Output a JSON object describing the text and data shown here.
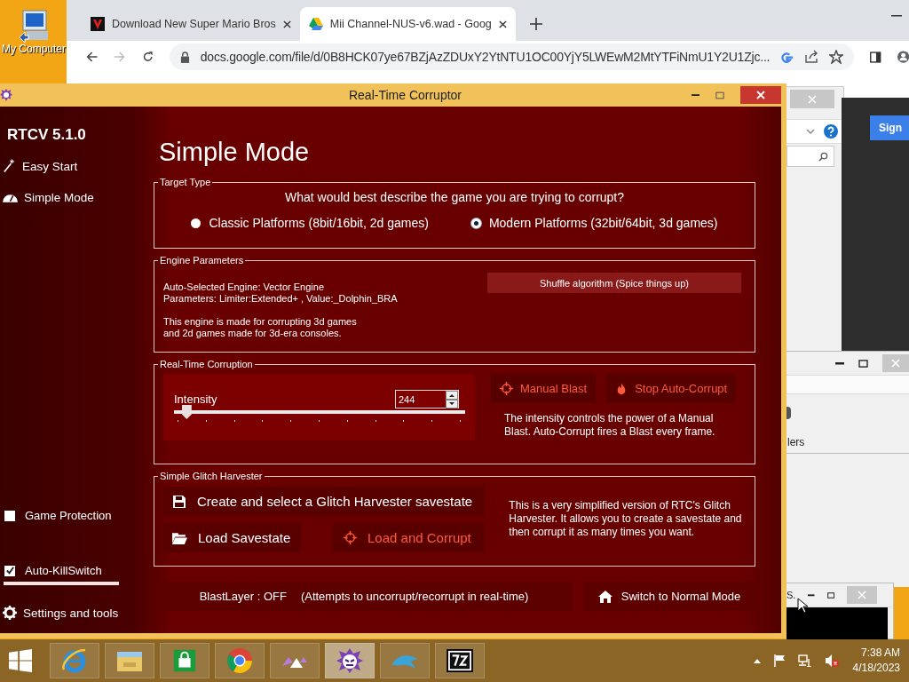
{
  "desktop_icons": [
    {
      "label": "My Computer"
    }
  ],
  "browser": {
    "tabs": [
      {
        "kind": "video",
        "title": "Download New Super Mario Bros",
        "selected": false
      },
      {
        "kind": "drive",
        "title": "Mii Channel-NUS-v6.wad - Goog",
        "selected": true
      }
    ],
    "address": "docs.google.com/file/d/0B8HCK07ye67BZjAzZDUxY2YtNTU1OC00YjY5LWEwM2MtYTFiNmU1Y2U1Zjc..."
  },
  "background_windows": {
    "sign_button": "Sign",
    "label_fragment": "lers",
    "title_fragment": "S."
  },
  "rtc": {
    "title": "Real-Time Corruptor",
    "version": "RTCV 5.1.0",
    "nav": [
      {
        "kind": "wand",
        "label": "Easy Start"
      },
      {
        "kind": "gauge",
        "label": "Simple Mode"
      }
    ],
    "options": [
      {
        "label": "Game Protection",
        "checked": false
      },
      {
        "label": "Auto-KillSwitch",
        "checked": true
      }
    ],
    "settings": "Settings and tools",
    "heading": "Simple Mode",
    "target_type": {
      "legend": "Target Type",
      "question": "What would best describe the game you are trying to corrupt?",
      "choices": [
        {
          "label": "Classic Platforms (8bit/16bit, 2d games)",
          "selected": false
        },
        {
          "label": "Modern Platforms (32bit/64bit, 3d games)",
          "selected": true
        }
      ]
    },
    "engine": {
      "legend": "Engine Parameters",
      "info": "Auto-Selected Engine: Vector Engine\nParameters: Limiter:Extended+ , Value:_Dolphin_BRA",
      "description": "This engine is made for corrupting 3d games\nand 2d games made for 3d-era consoles.",
      "shuffle": "Shuffle algorithm (Spice things up)"
    },
    "corruption": {
      "legend": "Real-Time Corruption",
      "intensity": {
        "label": "Intensity",
        "value": "244",
        "level": 0.03
      },
      "buttons": [
        {
          "kind": "crosshair",
          "label": "Manual Blast"
        },
        {
          "kind": "flame",
          "label": "Stop Auto-Corrupt"
        }
      ],
      "note": "The intensity controls the power of a Manual Blast. Auto-Corrupt fires a Blast every frame."
    },
    "harvester": {
      "legend": "Simple Glitch Harvester",
      "buttons": [
        {
          "kind": "save",
          "label": "Create and select a Glitch Harvester savestate"
        },
        {
          "kind": "folder",
          "label": "Load Savestate"
        },
        {
          "kind": "crosshair",
          "label": "Load and Corrupt"
        }
      ],
      "note": "This is a very simplified version of RTC's Glitch Harvester. It allows you to create a savestate and then corrupt it as many times you want."
    },
    "blastlayer": {
      "status": "BlastLayer : OFF",
      "hint": "(Attempts to uncorrupt/recorrupt in real-time)"
    },
    "normal_mode": "Switch to Normal Mode"
  },
  "taskbar": {
    "apps": [
      {
        "kind": "ie",
        "selected": false
      },
      {
        "kind": "explorer",
        "selected": false
      },
      {
        "kind": "store",
        "selected": false
      },
      {
        "kind": "chrome",
        "selected": false
      },
      {
        "kind": "triangle",
        "selected": false
      },
      {
        "kind": "rtc",
        "selected": true
      },
      {
        "kind": "dolphin",
        "selected": false
      },
      {
        "kind": "zip",
        "selected": false
      }
    ],
    "time": "7:38 AM",
    "date": "4/18/2023"
  }
}
